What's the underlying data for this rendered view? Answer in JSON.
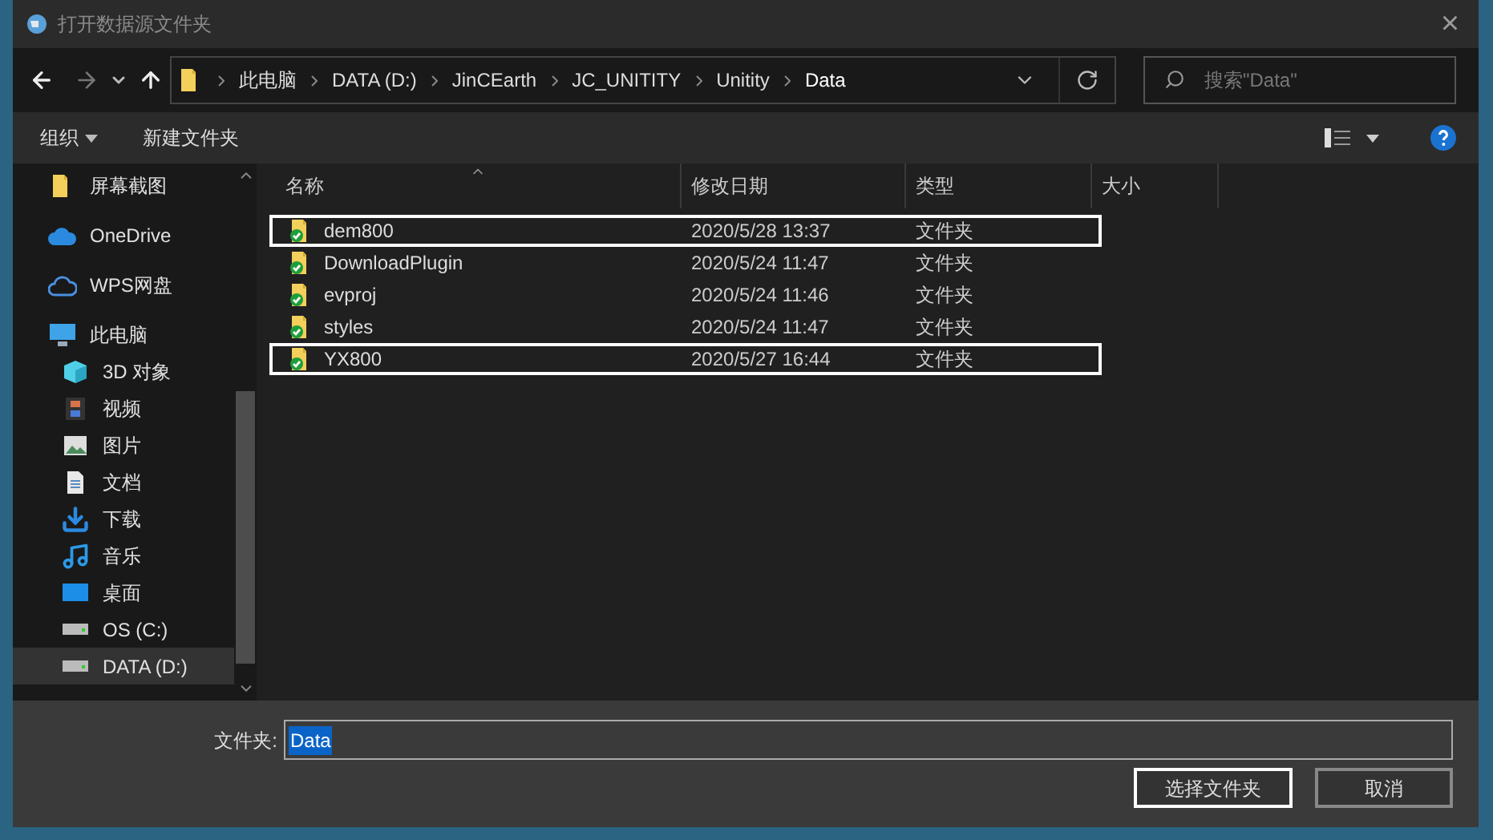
{
  "window": {
    "title": "打开数据源文件夹",
    "close": "×"
  },
  "breadcrumbs": [
    "此电脑",
    "DATA (D:)",
    "JinCEarth",
    "JC_UNITITY",
    "Unitity",
    "Data"
  ],
  "search": {
    "placeholder": "搜索\"Data\""
  },
  "toolbar": {
    "organize": "组织",
    "new_folder": "新建文件夹"
  },
  "sidebar": {
    "items": [
      {
        "label": "屏幕截图",
        "kind": "folder",
        "selected": false
      },
      {
        "label": "OneDrive",
        "kind": "cloud",
        "selected": false
      },
      {
        "label": "WPS网盘",
        "kind": "netdisk",
        "selected": false
      },
      {
        "label": "此电脑",
        "kind": "pc",
        "selected": false,
        "children": [
          {
            "label": "3D 对象",
            "kind": "objects",
            "selected": false
          },
          {
            "label": "视频",
            "kind": "videos",
            "selected": false
          },
          {
            "label": "图片",
            "kind": "pictures",
            "selected": false
          },
          {
            "label": "文档",
            "kind": "documents",
            "selected": false
          },
          {
            "label": "下载",
            "kind": "downloads",
            "selected": false
          },
          {
            "label": "音乐",
            "kind": "music",
            "selected": false
          },
          {
            "label": "桌面",
            "kind": "desktop",
            "selected": false
          },
          {
            "label": "OS (C:)",
            "kind": "drive",
            "selected": false
          },
          {
            "label": "DATA (D:)",
            "kind": "drive",
            "selected": true
          }
        ]
      }
    ]
  },
  "table": {
    "columns": [
      "名称",
      "修改日期",
      "类型",
      "大小"
    ],
    "rows": [
      {
        "name": "dem800",
        "modified": "2020/5/28 13:37",
        "type": "文件夹",
        "outlined": true
      },
      {
        "name": "DownloadPlugin",
        "modified": "2020/5/24 11:47",
        "type": "文件夹",
        "outlined": false
      },
      {
        "name": "evproj",
        "modified": "2020/5/24 11:46",
        "type": "文件夹",
        "outlined": false
      },
      {
        "name": "styles",
        "modified": "2020/5/24 11:47",
        "type": "文件夹",
        "outlined": false
      },
      {
        "name": "YX800",
        "modified": "2020/5/27 16:44",
        "type": "文件夹",
        "outlined": true
      }
    ]
  },
  "folder_field": {
    "label": "文件夹:",
    "value": "Data"
  },
  "buttons": [
    "选择文件夹",
    "取消"
  ]
}
